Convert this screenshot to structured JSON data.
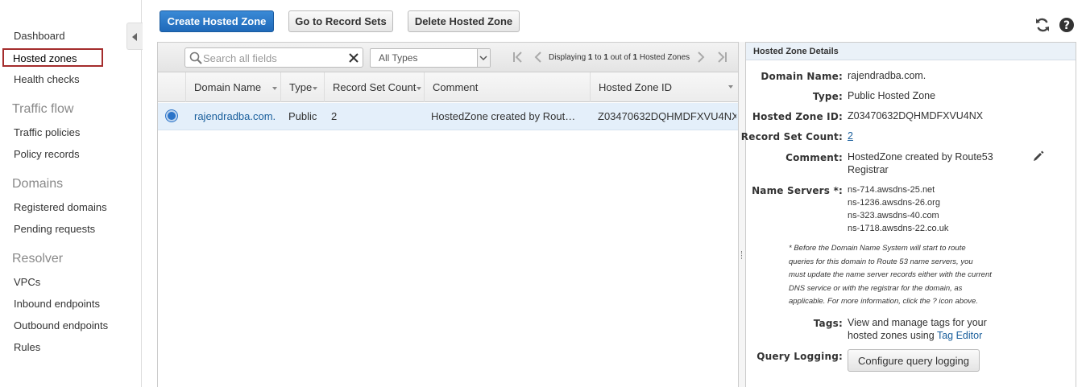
{
  "sidebar": {
    "dashboard": "Dashboard",
    "hosted_zones": "Hosted zones",
    "health_checks": "Health checks",
    "traffic_flow_heading": "Traffic flow",
    "traffic_policies": "Traffic policies",
    "policy_records": "Policy records",
    "domains_heading": "Domains",
    "registered_domains": "Registered domains",
    "pending_requests": "Pending requests",
    "resolver_heading": "Resolver",
    "vpcs": "VPCs",
    "inbound_endpoints": "Inbound endpoints",
    "outbound_endpoints": "Outbound endpoints",
    "rules": "Rules"
  },
  "toolbar": {
    "create_label": "Create Hosted Zone",
    "go_to_record_sets_label": "Go to Record Sets",
    "delete_label": "Delete Hosted Zone"
  },
  "grid": {
    "search_placeholder": "Search all fields",
    "type_filter": "All Types",
    "pager_prefix": "Displaying ",
    "pager_from": "1",
    "pager_mid1": " to ",
    "pager_to": "1",
    "pager_mid2": " out of ",
    "pager_total": "1",
    "pager_suffix": " Hosted Zones",
    "columns": {
      "domain": "Domain Name",
      "type": "Type",
      "count": "Record Set Count",
      "comment": "Comment",
      "zone_id": "Hosted Zone ID"
    },
    "rows": [
      {
        "domain": "rajendradba.com.",
        "type": "Public",
        "count": "2",
        "comment": "HostedZone created by Route53 Registrar",
        "zone_id": "Z03470632DQHMDFXVU4NX"
      }
    ]
  },
  "details": {
    "title": "Hosted Zone Details",
    "domain_name_label": "Domain Name:",
    "domain_name": "rajendradba.com.",
    "type_label": "Type:",
    "type": "Public Hosted Zone",
    "zone_id_label": "Hosted Zone ID:",
    "zone_id": "Z03470632DQHMDFXVU4NX",
    "count_label": "Record Set Count:",
    "count": "2",
    "comment_label": "Comment:",
    "comment_line1": "HostedZone created by Route53",
    "comment_line2": "Registrar",
    "ns_label": "Name Servers *:",
    "name_servers": [
      "ns-714.awsdns-25.net",
      "ns-1236.awsdns-26.org",
      "ns-323.awsdns-40.com",
      "ns-1718.awsdns-22.co.uk"
    ],
    "note_lines": [
      "* Before the Domain Name System will start to route",
      "queries for this domain to Route 53 name servers, you",
      "must update the name server records either with the current",
      "DNS service or with the registrar for the domain, as",
      "applicable. For more information, click the ? icon above."
    ],
    "tags_label": "Tags:",
    "tags_line1": "View and manage tags for your",
    "tags_line2": "hosted zones using ",
    "tags_link": "Tag Editor",
    "query_logging_label": "Query Logging:",
    "query_logging_button": "Configure query logging"
  },
  "icons": {
    "refresh": "refresh-icon",
    "help": "help-icon",
    "edit": "pencil-icon"
  },
  "colors": {
    "primary_button": "#1f69b9",
    "selected_row": "#e4effa",
    "active_nav_border": "#a42c2c",
    "link": "#1a5f9c"
  }
}
